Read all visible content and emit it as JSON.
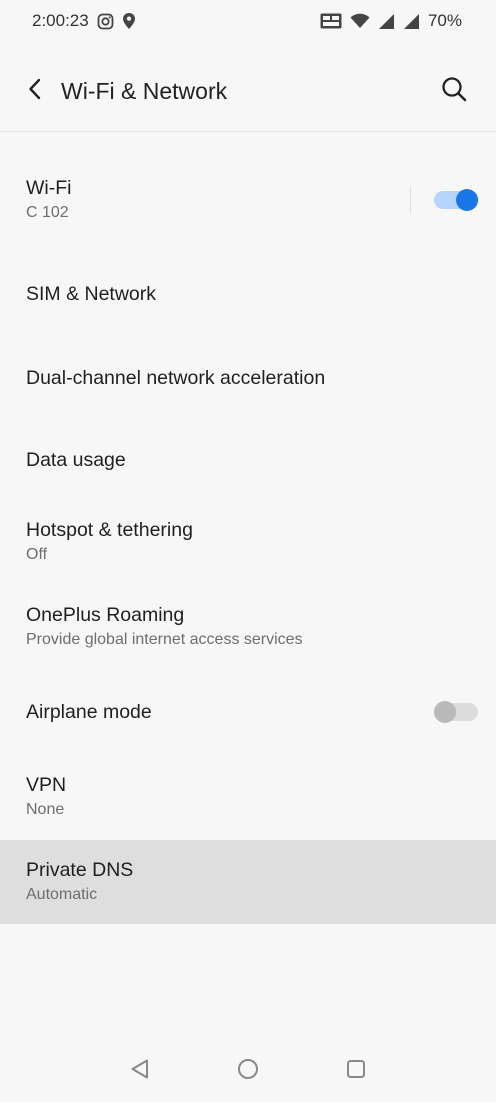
{
  "status_bar": {
    "time": "2:00:23",
    "battery": "70%",
    "icons": [
      "instagram-icon",
      "location-pin-icon",
      "volte-lte-icon",
      "wifi-signal-icon",
      "cell-signal-icon",
      "cell-signal-roaming-icon"
    ]
  },
  "app_bar": {
    "title": "Wi-Fi & Network",
    "back_icon": "chevron-left-icon",
    "search_icon": "search-icon"
  },
  "settings": [
    {
      "title": "Wi-Fi",
      "subtitle": "C 102",
      "toggle": true
    },
    {
      "title": "SIM & Network"
    },
    {
      "title": "Dual-channel network acceleration"
    },
    {
      "title": "Data usage"
    },
    {
      "title": "Hotspot & tethering",
      "subtitle": "Off"
    },
    {
      "title": "OnePlus Roaming",
      "subtitle": "Provide global internet access services"
    },
    {
      "title": "Airplane mode",
      "toggle": false
    },
    {
      "title": "VPN",
      "subtitle": "None"
    },
    {
      "title": "Private DNS",
      "subtitle": "Automatic",
      "selected": true
    }
  ],
  "nav_bar": {
    "icons": [
      "back-triangle-icon",
      "home-circle-icon",
      "recents-square-icon"
    ]
  },
  "colors": {
    "accent": "#1976e8",
    "background": "#f7f7f7",
    "selected_row": "#dedede"
  }
}
